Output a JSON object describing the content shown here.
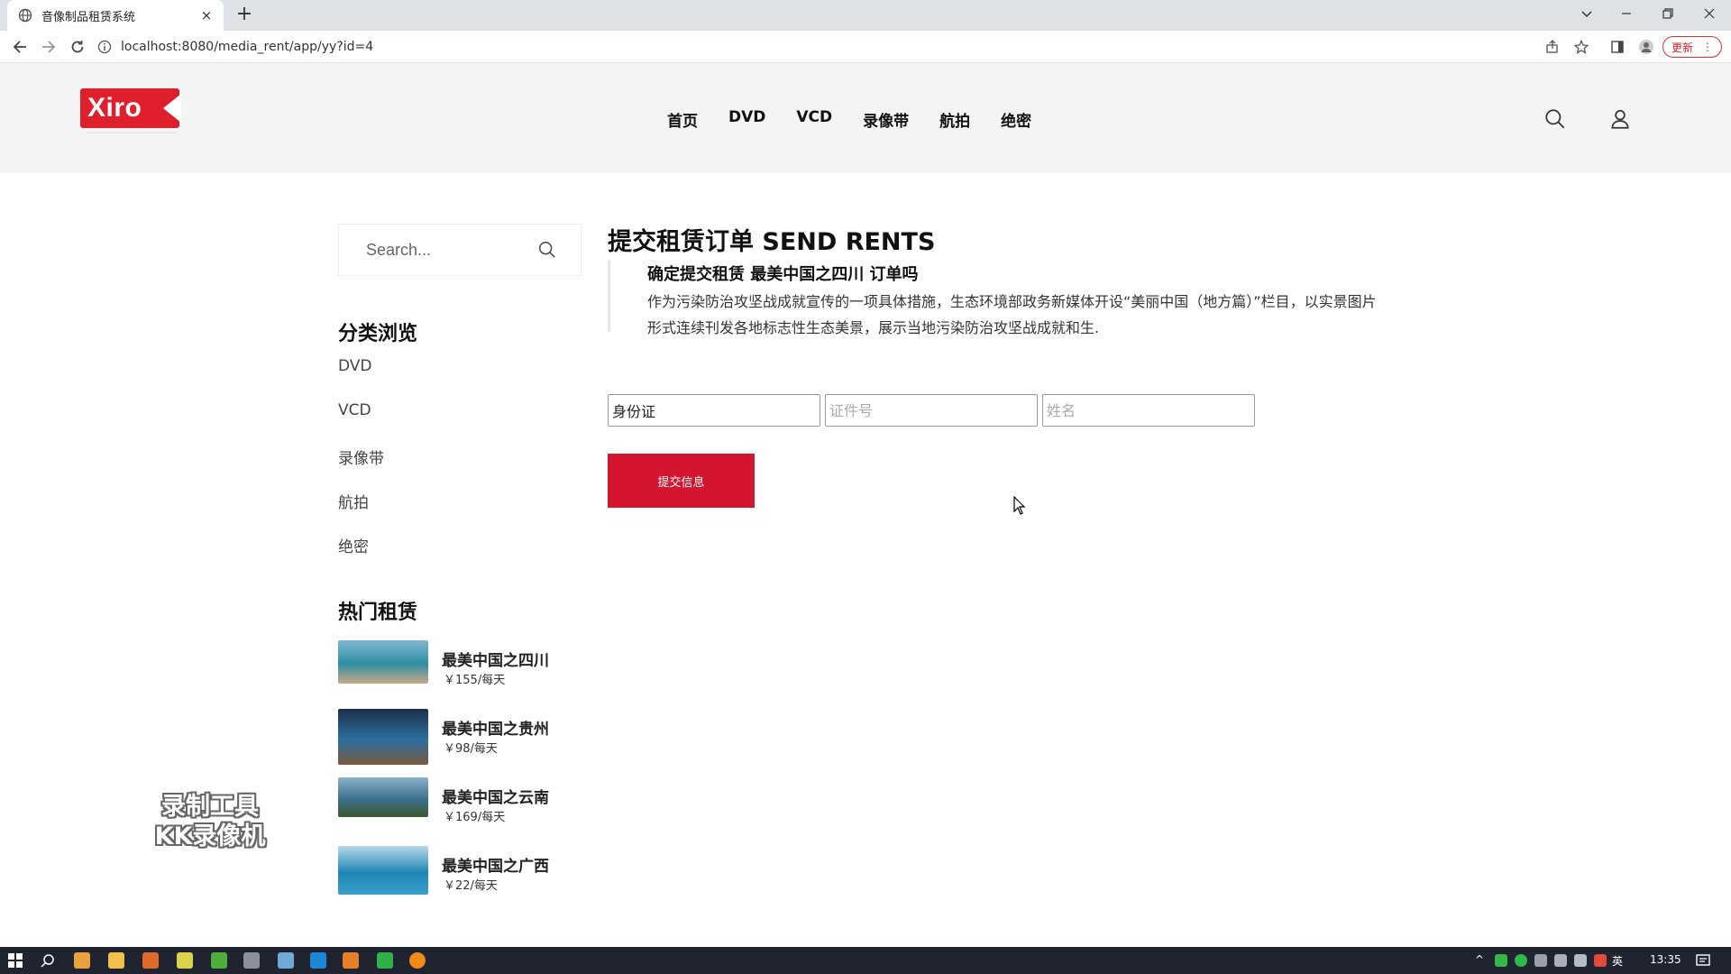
{
  "browser": {
    "tab_title": "音像制品租赁系统",
    "tab_close": "×",
    "new_tab": "+",
    "url": "localhost:8080/media_rent/app/yy?id=4",
    "update_label": "更新",
    "update_menu": "⋮"
  },
  "header": {
    "logo_text": "Xiro",
    "nav": [
      "首页",
      "DVD",
      "VCD",
      "录像带",
      "航拍",
      "绝密"
    ]
  },
  "sidebar": {
    "search_placeholder": "Search...",
    "categories_heading": "分类浏览",
    "categories": [
      "DVD",
      "VCD",
      "录像带",
      "航拍",
      "绝密"
    ],
    "hot_heading": "热门租赁",
    "hot_items": [
      {
        "name": "最美中国之四川",
        "price": "￥155/每天",
        "thumb_colors": [
          "#7fb6cf",
          "#2f8fa3",
          "#c9a88a"
        ]
      },
      {
        "name": "最美中国之贵州",
        "price": "￥98/每天",
        "thumb_colors": [
          "#1b2f4a",
          "#2d6fa0",
          "#7a5a3f"
        ]
      },
      {
        "name": "最美中国之云南",
        "price": "￥169/每天",
        "thumb_colors": [
          "#8cb0c8",
          "#3b6f8c",
          "#3d5a2e"
        ]
      },
      {
        "name": "最美中国之广西",
        "price": "￥22/每天",
        "thumb_colors": [
          "#b9d8e8",
          "#1d86b5",
          "#3a9fc9"
        ]
      }
    ]
  },
  "main": {
    "title": "提交租赁订单 SEND RENTS",
    "confirm_title": "确定提交租赁 最美中国之四川 订单吗",
    "description": "作为污染防治攻坚战成就宣传的一项具体措施，生态环境部政务新媒体开设“美丽中国（地方篇）”栏目，以实景图片形式连续刊发各地标志性生态美景，展示当地污染防治攻坚战成就和生.",
    "form": {
      "id_type_value": "身份证",
      "id_number_placeholder": "证件号",
      "name_placeholder": "姓名"
    },
    "submit_label": "提交信息"
  },
  "watermark": {
    "line1": "录制工具",
    "line2": "KK录像机"
  },
  "taskbar": {
    "ime": "英",
    "time": "13:35"
  },
  "colors": {
    "brand_red": "#e01f2d",
    "submit_red": "#d4152f",
    "header_bg": "#f4f4f4",
    "taskbar_bg": "#1f2430"
  }
}
